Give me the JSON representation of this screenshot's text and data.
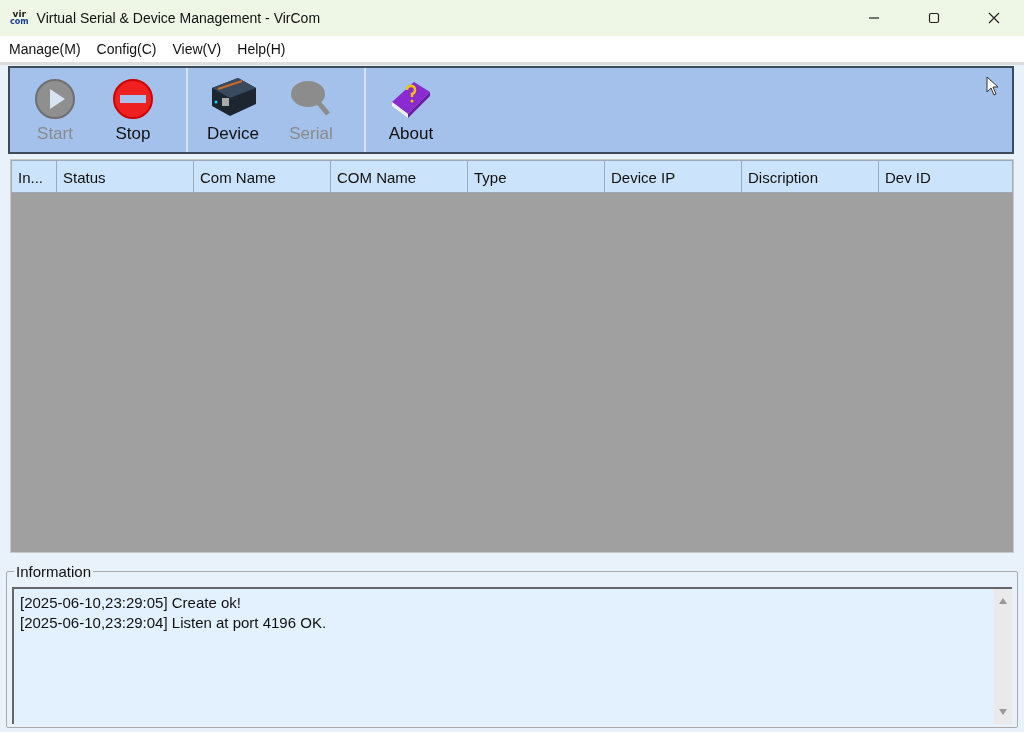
{
  "window": {
    "title": "Virtual Serial & Device Management - VirCom",
    "logo_lines": [
      "vir",
      "com"
    ]
  },
  "menu": [
    "Manage(M)",
    "Config(C)",
    "View(V)",
    "Help(H)"
  ],
  "toolbar": [
    [
      {
        "label": "Start",
        "kind": "start",
        "disabled": true
      },
      {
        "label": "Stop",
        "kind": "stop",
        "disabled": false
      }
    ],
    [
      {
        "label": "Device",
        "kind": "device",
        "disabled": false
      },
      {
        "label": "Serial",
        "kind": "serial",
        "disabled": true
      }
    ],
    [
      {
        "label": "About",
        "kind": "about",
        "disabled": false
      }
    ]
  ],
  "table": {
    "columns": [
      "In...",
      "Status",
      "Com Name",
      "COM Name",
      "Type",
      "Device IP",
      "Discription",
      "Dev ID"
    ]
  },
  "information": {
    "title": "Information",
    "lines": [
      "[2025-06-10,23:29:05] Create ok!",
      "[2025-06-10,23:29:04] Listen at port 4196 OK."
    ]
  }
}
